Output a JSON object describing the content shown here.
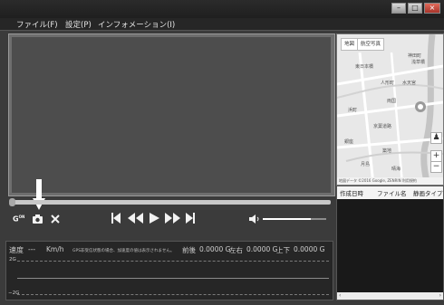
{
  "window": {
    "controls": [
      "–",
      "□",
      "×"
    ]
  },
  "menu": {
    "items": [
      "ファイル(F)",
      "設定(P)",
      "インフォメーション(I)"
    ]
  },
  "player": {
    "gsensor_label": "G",
    "gsensor_superscript": "ON",
    "volume_level": 0.75,
    "seek_position": 0.0
  },
  "data_strip": {
    "speed_label": "速度",
    "speed_value": "---",
    "speed_unit": "Km/h",
    "gps_notice": "GPS非受信状態の場合、加速度の値は表示されません。",
    "front_back_label": "前後",
    "front_back_value": "0.0000 G",
    "left_right_label": "左右",
    "left_right_value": "0.0000 G",
    "up_down_label": "上下",
    "up_down_value": "0.0000 G",
    "axis_top": "2G",
    "axis_bottom": "−2G"
  },
  "map": {
    "tab_map": "地図",
    "tab_aerial": "航空写真",
    "labels": [
      "神田町",
      "浅草橋",
      "東日本橋",
      "人形町",
      "水天宮",
      "浜町",
      "両国",
      "京葉道路",
      "銀座",
      "築地",
      "月島",
      "晴海"
    ],
    "zoom_in": "+",
    "zoom_out": "−",
    "footer": "地図データ ©2016 Google, ZENRIN 利用規約"
  },
  "filelist": {
    "headers": [
      "作成日時",
      "ファイル名",
      "静画タイプ"
    ]
  }
}
